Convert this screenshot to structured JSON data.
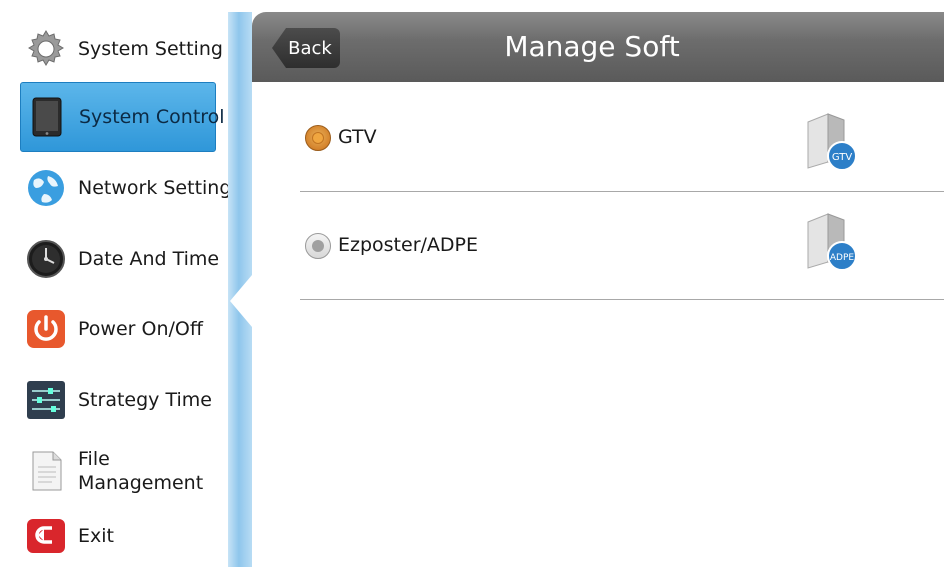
{
  "sidebar": {
    "items": [
      {
        "label": "System Setting",
        "icon": "gear-icon",
        "active": false
      },
      {
        "label": "System Control",
        "icon": "tablet-icon",
        "active": true
      },
      {
        "label": "Network Setting",
        "icon": "globe-icon",
        "active": false
      },
      {
        "label": "Date And Time",
        "icon": "clock-icon",
        "active": false
      },
      {
        "label": "Power On/Off",
        "icon": "power-icon",
        "active": false
      },
      {
        "label": "Strategy Time",
        "icon": "sliders-icon",
        "active": false
      },
      {
        "label": "File\nManagement",
        "icon": "document-icon",
        "active": false
      },
      {
        "label": "Exit",
        "icon": "exit-icon",
        "active": false
      }
    ]
  },
  "header": {
    "back_label": "Back",
    "title": "Manage Soft"
  },
  "options": [
    {
      "label": "GTV",
      "selected": true,
      "badge": "GTV"
    },
    {
      "label": "Ezposter/ADPE",
      "selected": false,
      "badge": "ADPE"
    }
  ],
  "colors": {
    "accent": "#2f97d9",
    "header_bg": "#6d6d6d",
    "selected_radio": "#d4822b"
  }
}
